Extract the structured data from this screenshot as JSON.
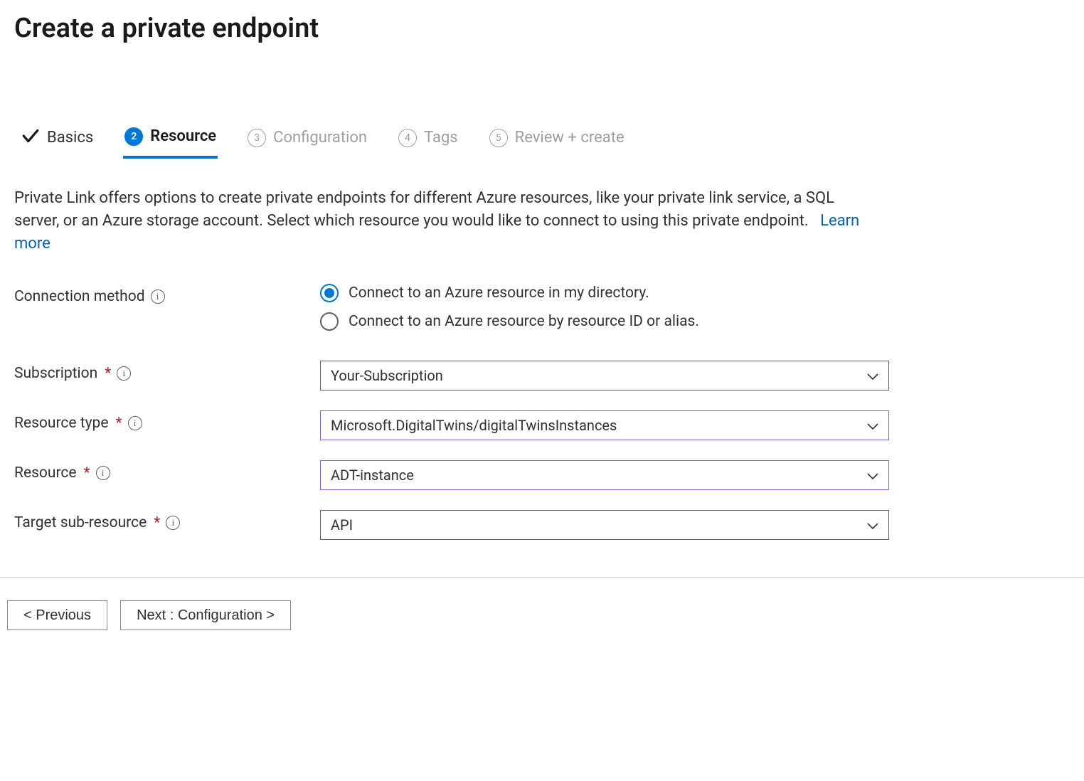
{
  "header": {
    "title": "Create a private endpoint"
  },
  "tabs": [
    {
      "label": "Basics",
      "state": "completed"
    },
    {
      "label": "Resource",
      "state": "active",
      "step": "2"
    },
    {
      "label": "Configuration",
      "state": "disabled",
      "step": "3"
    },
    {
      "label": "Tags",
      "state": "disabled",
      "step": "4"
    },
    {
      "label": "Review + create",
      "state": "disabled",
      "step": "5"
    }
  ],
  "description": {
    "text": "Private Link offers options to create private endpoints for different Azure resources, like your private link service, a SQL server, or an Azure storage account. Select which resource you would like to connect to using this private endpoint.",
    "link_label": "Learn more"
  },
  "fields": {
    "connection_method": {
      "label": "Connection method",
      "options": [
        {
          "label": "Connect to an Azure resource in my directory.",
          "checked": true
        },
        {
          "label": "Connect to an Azure resource by resource ID or alias.",
          "checked": false
        }
      ]
    },
    "subscription": {
      "label": "Subscription",
      "value": "Your-Subscription"
    },
    "resource_type": {
      "label": "Resource type",
      "value": "Microsoft.DigitalTwins/digitalTwinsInstances"
    },
    "resource": {
      "label": "Resource",
      "value": "ADT-instance"
    },
    "target_sub_resource": {
      "label": "Target sub-resource",
      "value": "API"
    }
  },
  "footer": {
    "previous_label": "< Previous",
    "next_label": "Next : Configuration >"
  }
}
